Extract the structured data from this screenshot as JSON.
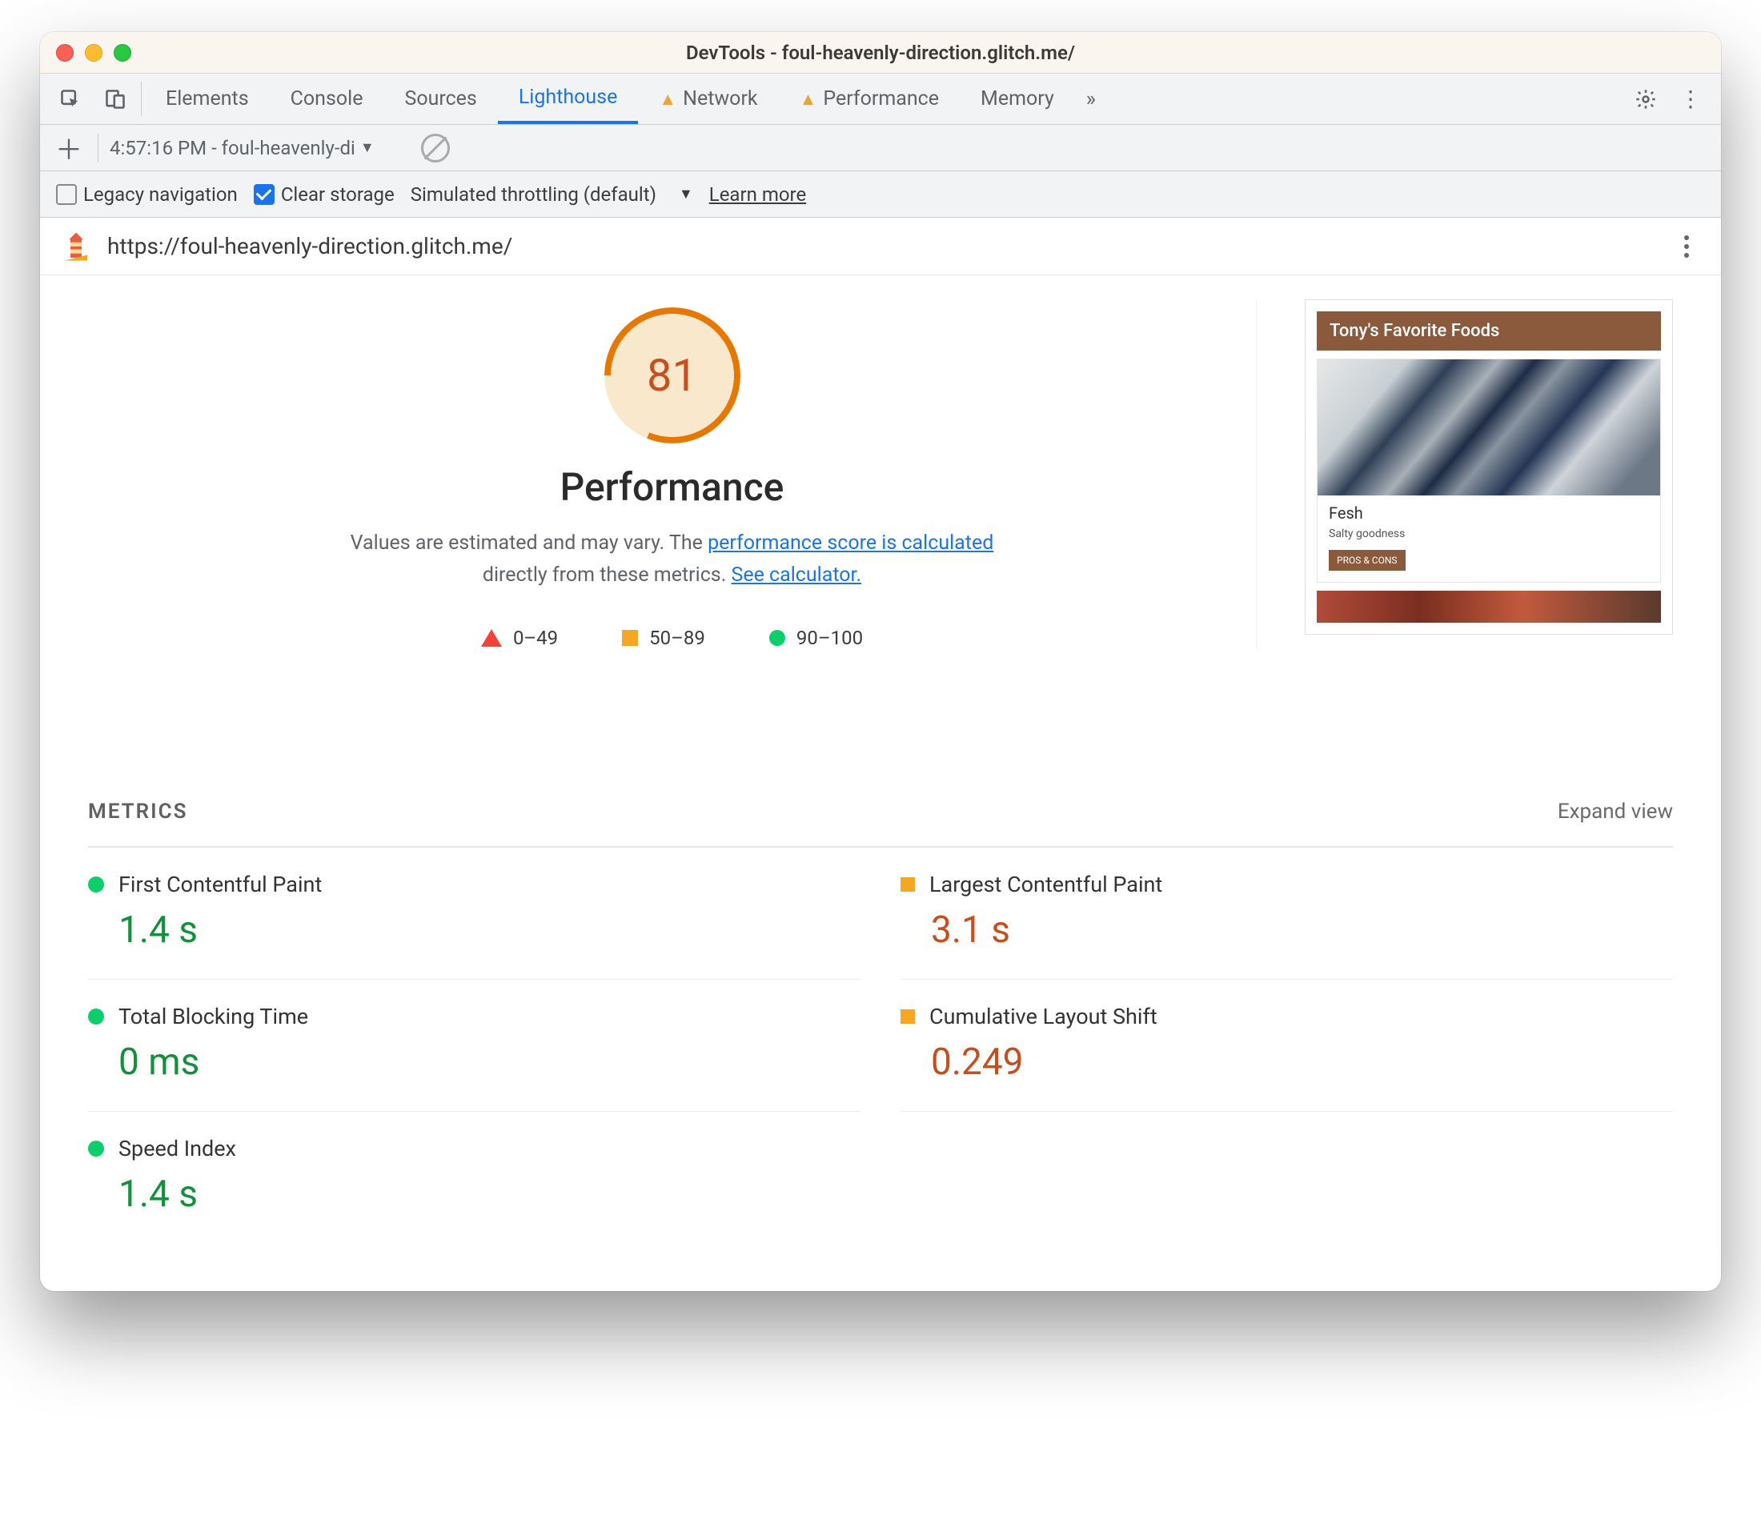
{
  "window": {
    "title": "DevTools - foul-heavenly-direction.glitch.me/"
  },
  "tabs": {
    "items": [
      {
        "label": "Elements",
        "warn": false,
        "active": false
      },
      {
        "label": "Console",
        "warn": false,
        "active": false
      },
      {
        "label": "Sources",
        "warn": false,
        "active": false
      },
      {
        "label": "Lighthouse",
        "warn": false,
        "active": true
      },
      {
        "label": "Network",
        "warn": true,
        "active": false
      },
      {
        "label": "Performance",
        "warn": true,
        "active": false
      },
      {
        "label": "Memory",
        "warn": false,
        "active": false
      }
    ]
  },
  "toolbar2": {
    "report_dropdown": "4:57:16 PM - foul-heavenly-di"
  },
  "toolbar3": {
    "legacy_label": "Legacy navigation",
    "legacy_checked": false,
    "clear_label": "Clear storage",
    "clear_checked": true,
    "throttle_label": "Simulated throttling (default)",
    "learn_more": "Learn more"
  },
  "report": {
    "url": "https://foul-heavenly-direction.glitch.me/",
    "score": "81",
    "category": "Performance",
    "desc_pre": "Values are estimated and may vary. The ",
    "desc_link1": "performance score is calculated",
    "desc_mid": " directly from these metrics. ",
    "desc_link2": "See calculator.",
    "legend": {
      "a": "0–49",
      "b": "50–89",
      "c": "90–100"
    }
  },
  "preview": {
    "header": "Tony's Favorite Foods",
    "card_title": "Fesh",
    "card_sub": "Salty goodness",
    "card_btn": "PROS & CONS"
  },
  "metrics": {
    "heading": "METRICS",
    "expand": "Expand view",
    "items": [
      {
        "name": "First Contentful Paint",
        "value": "1.4 s",
        "status": "green"
      },
      {
        "name": "Largest Contentful Paint",
        "value": "3.1 s",
        "status": "orange"
      },
      {
        "name": "Total Blocking Time",
        "value": "0 ms",
        "status": "green"
      },
      {
        "name": "Cumulative Layout Shift",
        "value": "0.249",
        "status": "orange"
      },
      {
        "name": "Speed Index",
        "value": "1.4 s",
        "status": "green"
      }
    ]
  }
}
